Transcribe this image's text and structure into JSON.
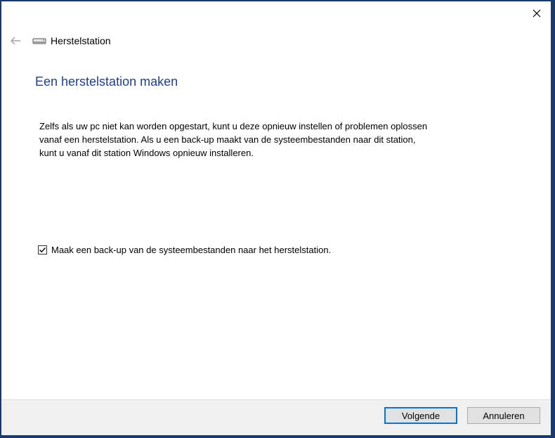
{
  "window": {
    "title": "Herstelstation",
    "close_icon": "close-icon",
    "back_icon": "back-arrow-icon",
    "drive_icon": "drive-icon"
  },
  "main": {
    "heading": "Een herstelstation maken",
    "description_lines": [
      "Zelfs als uw pc niet kan worden opgestart, kunt u deze opnieuw instellen of problemen oplossen",
      "vanaf een herstelstation. Als u een back-up maakt van de systeembestanden naar dit station,",
      "kunt u vanaf dit station Windows opnieuw installeren."
    ],
    "checkbox": {
      "label": "Maak een back-up van de systeembestanden naar het herstelstation.",
      "checked": true
    }
  },
  "footer": {
    "next_label": "Volgende",
    "cancel_label": "Annuleren"
  },
  "colors": {
    "heading": "#1f3f8f",
    "primary_border": "#0078d7",
    "footer_bg": "#f0f0f0"
  }
}
